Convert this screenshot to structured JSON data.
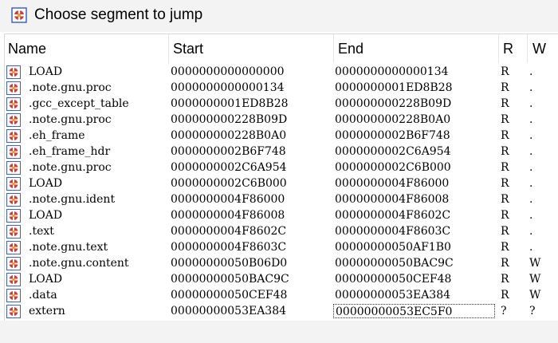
{
  "window": {
    "title": "Choose segment to jump",
    "icon": "ida-segment-icon"
  },
  "table": {
    "columns": [
      "Name",
      "Start",
      "End",
      "R",
      "W"
    ],
    "rows": [
      {
        "name": "LOAD",
        "start": "0000000000000000",
        "end": "0000000000000134",
        "r": "R",
        "w": "."
      },
      {
        "name": ".note.gnu.proc",
        "start": "0000000000000134",
        "end": "0000000001ED8B28",
        "r": "R",
        "w": "."
      },
      {
        "name": ".gcc_except_table",
        "start": "0000000001ED8B28",
        "end": "000000000228B09D",
        "r": "R",
        "w": "."
      },
      {
        "name": ".note.gnu.proc",
        "start": "000000000228B09D",
        "end": "000000000228B0A0",
        "r": "R",
        "w": "."
      },
      {
        "name": ".eh_frame",
        "start": "000000000228B0A0",
        "end": "0000000002B6F748",
        "r": "R",
        "w": "."
      },
      {
        "name": ".eh_frame_hdr",
        "start": "0000000002B6F748",
        "end": "0000000002C6A954",
        "r": "R",
        "w": "."
      },
      {
        "name": ".note.gnu.proc",
        "start": "0000000002C6A954",
        "end": "0000000002C6B000",
        "r": "R",
        "w": "."
      },
      {
        "name": "LOAD",
        "start": "0000000002C6B000",
        "end": "0000000004F86000",
        "r": "R",
        "w": "."
      },
      {
        "name": ".note.gnu.ident",
        "start": "0000000004F86000",
        "end": "0000000004F86008",
        "r": "R",
        "w": "."
      },
      {
        "name": "LOAD",
        "start": "0000000004F86008",
        "end": "0000000004F8602C",
        "r": "R",
        "w": "."
      },
      {
        "name": ".text",
        "start": "0000000004F8602C",
        "end": "0000000004F8603C",
        "r": "R",
        "w": "."
      },
      {
        "name": ".note.gnu.text",
        "start": "0000000004F8603C",
        "end": "00000000050AF1B0",
        "r": "R",
        "w": "."
      },
      {
        "name": ".note.gnu.content",
        "start": "00000000050B06D0",
        "end": "00000000050BAC9C",
        "r": "R",
        "w": "W"
      },
      {
        "name": "LOAD",
        "start": "00000000050BAC9C",
        "end": "00000000050CEF48",
        "r": "R",
        "w": "W"
      },
      {
        "name": ".data",
        "start": "00000000050CEF48",
        "end": "00000000053EA384",
        "r": "R",
        "w": "W"
      },
      {
        "name": "extern",
        "start": "00000000053EA384",
        "end": "00000000053EC5F0",
        "r": "?",
        "w": "?",
        "selected": true
      }
    ]
  },
  "colors": {
    "icon_blue": "#3c64c8",
    "icon_red": "#d23c32",
    "icon_orange": "#f0a028",
    "titlebar_bg": "#f3f3f3"
  }
}
